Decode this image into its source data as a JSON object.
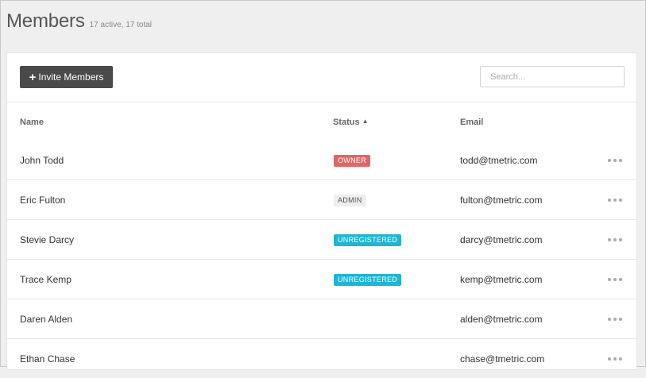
{
  "header": {
    "title": "Members",
    "counts": "17 active, 17 total"
  },
  "toolbar": {
    "invite_icon": "plus-icon",
    "invite_label": "Invite Members",
    "search_placeholder": "Search..."
  },
  "table": {
    "columns": {
      "name": "Name",
      "status": "Status",
      "email": "Email"
    },
    "sort": {
      "column": "status",
      "direction": "asc"
    },
    "rows": [
      {
        "name": "John Todd",
        "status": "OWNER",
        "status_type": "owner",
        "email": "todd@tmetric.com"
      },
      {
        "name": "Eric Fulton",
        "status": "ADMIN",
        "status_type": "admin",
        "email": "fulton@tmetric.com"
      },
      {
        "name": "Stevie Darcy",
        "status": "UNREGISTERED",
        "status_type": "unregistered",
        "email": "darcy@tmetric.com"
      },
      {
        "name": "Trace Kemp",
        "status": "UNREGISTERED",
        "status_type": "unregistered",
        "email": "kemp@tmetric.com"
      },
      {
        "name": "Daren Alden",
        "status": "",
        "status_type": "",
        "email": "alden@tmetric.com"
      },
      {
        "name": "Ethan Chase",
        "status": "",
        "status_type": "",
        "email": "chase@tmetric.com"
      }
    ]
  },
  "colors": {
    "owner": "#e06666",
    "admin": "#eeeeee",
    "unregistered": "#1fb5d5",
    "button": "#4a4a4a"
  }
}
